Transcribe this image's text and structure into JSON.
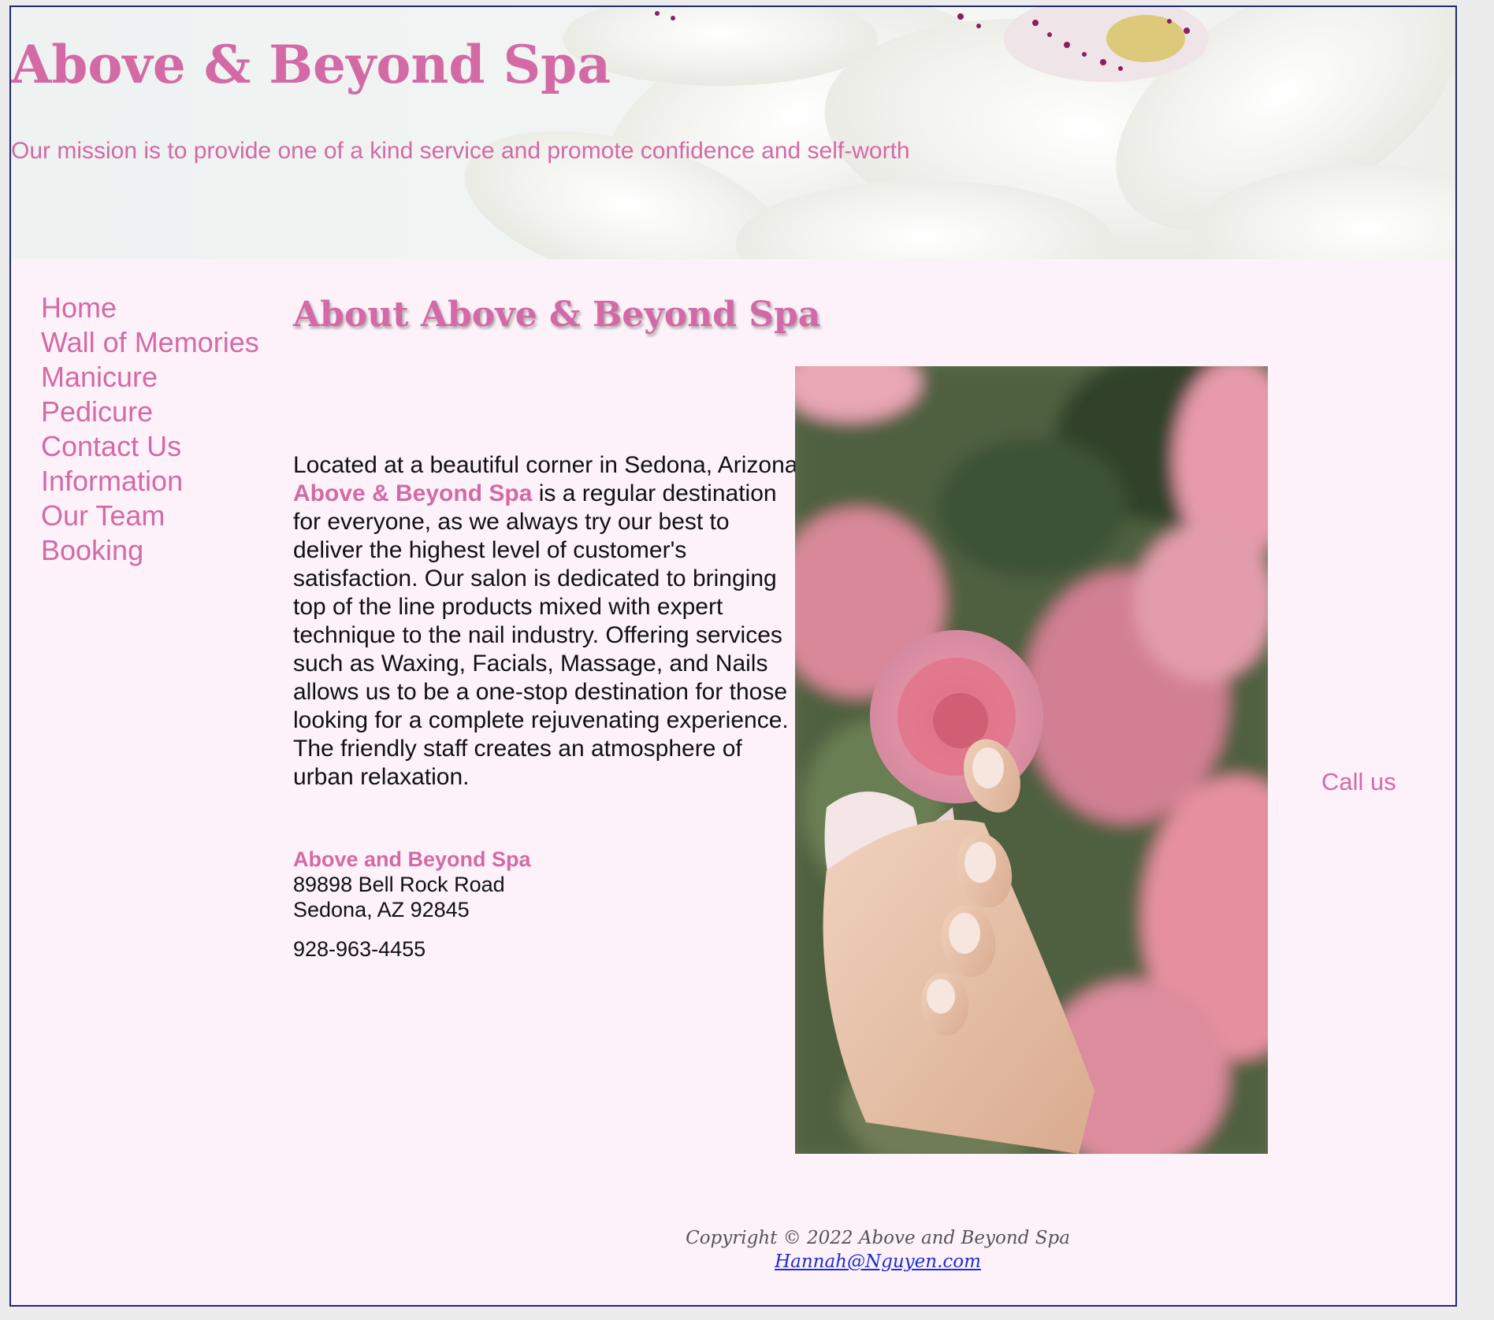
{
  "site": {
    "title": "Above & Beyond Spa",
    "mission": "Our mission is to provide one of a kind service and promote confidence and self-worth"
  },
  "nav": {
    "items": [
      {
        "label": "Home"
      },
      {
        "label": "Wall of Memories"
      },
      {
        "label": "Manicure"
      },
      {
        "label": "Pedicure"
      },
      {
        "label": "Contact Us"
      },
      {
        "label": "Information"
      },
      {
        "label": "Our Team"
      },
      {
        "label": "Booking"
      }
    ]
  },
  "main": {
    "heading": "About Above & Beyond Spa",
    "para_intro": "Located at a beautiful corner in Sedona, Arizona, ",
    "para_spa_name": "Above & Beyond Spa",
    "para_rest": " is a regular destination for everyone, as we always try our best to deliver the highest level of customer's satisfaction. Our salon is dedicated to bringing top of the line products mixed with expert technique to the nail industry. Offering services such as Waxing, Facials, Massage, and Nails allows us to be a one-stop destination for those looking for a complete rejuvenating experience. The friendly staff creates an atmosphere of urban relaxation.",
    "address": {
      "name": "Above and Beyond Spa",
      "street": "89898 Bell Rock Road",
      "city": "Sedona, AZ 92845",
      "phone": "928-963-4455"
    },
    "call_us": "Call us"
  },
  "footer": {
    "copyright": "Copyright © 2022 Above and Beyond Spa",
    "email": "Hannah@Nguyen.com"
  },
  "colors": {
    "accent": "#d36aa6",
    "border": "#1f2a6e",
    "background": "#fdf2fa",
    "link": "#1d2bd6"
  }
}
